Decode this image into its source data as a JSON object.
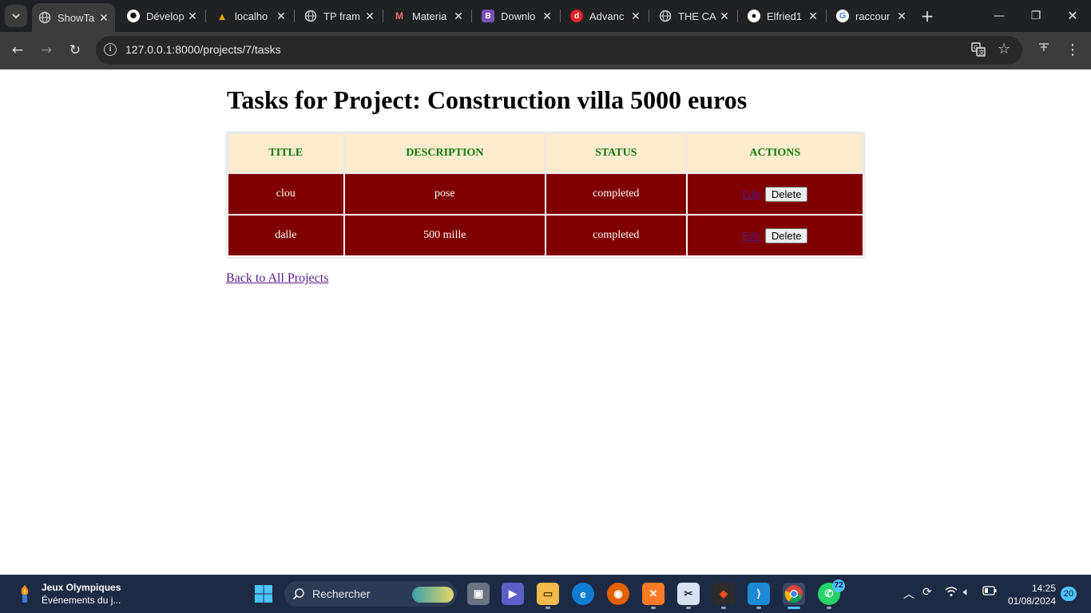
{
  "browser": {
    "tabs": [
      {
        "title": "ShowTa",
        "favicon": "globe-icon",
        "active": true
      },
      {
        "title": "Dévelop",
        "favicon": "openai-icon"
      },
      {
        "title": "localho",
        "favicon": "xampp-icon"
      },
      {
        "title": "TP fram",
        "favicon": "globe-icon"
      },
      {
        "title": "Materia",
        "favicon": "materialize-icon"
      },
      {
        "title": "Downlo",
        "favicon": "bootstrap-icon"
      },
      {
        "title": "Advanc",
        "favicon": "dailymotion-icon"
      },
      {
        "title": "THE CA",
        "favicon": "globe-icon"
      },
      {
        "title": "Elfried1",
        "favicon": "github-icon"
      },
      {
        "title": "raccour",
        "favicon": "google-icon"
      }
    ],
    "url": "127.0.0.1:8000/projects/7/tasks"
  },
  "page": {
    "title": "Tasks for Project: Construction villa 5000 euros",
    "table": {
      "headers": [
        "TITLE",
        "DESCRIPTION",
        "STATUS",
        "ACTIONS"
      ],
      "rows": [
        {
          "title": "clou",
          "description": "pose",
          "status": "completed",
          "edit": "Edit",
          "delete": "Delete"
        },
        {
          "title": "dalle",
          "description": "500 mille",
          "status": "completed",
          "edit": "Edit",
          "delete": "Delete"
        }
      ]
    },
    "back_link": "Back to All Projects"
  },
  "taskbar": {
    "weather_title": "Jeux Olympiques",
    "weather_subtitle": "Événements du j...",
    "search_label": "Rechercher",
    "whatsapp_badge": "72",
    "time": "14:25",
    "date": "01/08/2024",
    "notifications": "20"
  },
  "colors": {
    "header_bg": "#ffebcd",
    "header_text": "#0b7a0b",
    "row_bg": "#800000",
    "link": "#551a8b"
  }
}
